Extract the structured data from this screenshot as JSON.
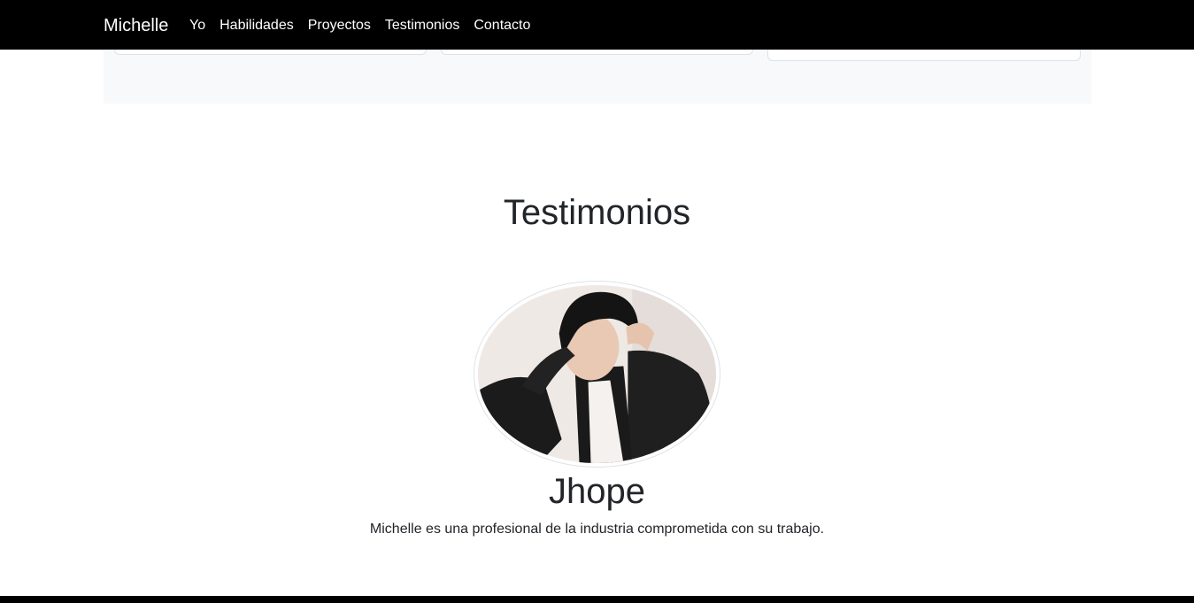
{
  "navbar": {
    "brand": "Michelle",
    "links": [
      {
        "label": "Yo"
      },
      {
        "label": "Habilidades"
      },
      {
        "label": "Proyectos"
      },
      {
        "label": "Testimonios"
      },
      {
        "label": "Contacto"
      }
    ]
  },
  "testimonials": {
    "title": "Testimonios",
    "items": [
      {
        "name": "Jhope",
        "quote": "Michelle es una profesional de la industria comprometida con su trabajo.",
        "avatar": "portrait-photo"
      }
    ]
  },
  "colors": {
    "navbar_bg": "#000000",
    "panel_bg": "#f8f9fa",
    "text": "#212529"
  }
}
